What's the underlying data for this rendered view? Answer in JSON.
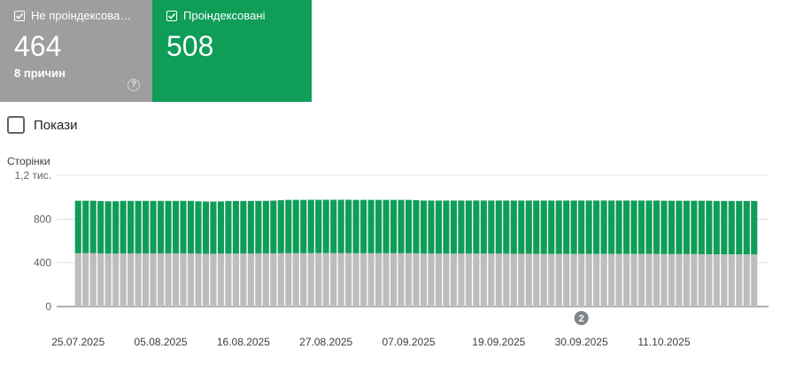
{
  "cards": {
    "not_indexed": {
      "title": "Не проіндексова…",
      "value": "464",
      "subtitle": "8 причин",
      "help": "?"
    },
    "indexed": {
      "title": "Проіндексовані",
      "value": "508",
      "help": "?"
    }
  },
  "show_toggle": {
    "label": "Покази",
    "checked": false
  },
  "colors": {
    "not_indexed": "#bdbdbd",
    "indexed": "#0f9d58",
    "grid": "#e0e0e0",
    "axis": "#5f6368"
  },
  "chart_data": {
    "type": "bar",
    "stacked": true,
    "ylabel": "Сторінки",
    "ylim": [
      0,
      1200
    ],
    "y_ticks": [
      {
        "value": 0,
        "label": "0"
      },
      {
        "value": 400,
        "label": "400"
      },
      {
        "value": 800,
        "label": "800"
      },
      {
        "value": 1200,
        "label": "1,2 тис."
      }
    ],
    "x_tick_labels": [
      "25.07.2025",
      "05.08.2025",
      "16.08.2025",
      "27.08.2025",
      "07.09.2025",
      "19.09.2025",
      "30.09.2025",
      "11.10.2025"
    ],
    "x_tick_index": [
      0,
      11,
      22,
      33,
      44,
      56,
      67,
      78
    ],
    "annotation": {
      "label": "2",
      "index": 67
    },
    "series": [
      {
        "name": "Не проіндексова…",
        "values": [
          488,
          489,
          489,
          486,
          485,
          485,
          486,
          486,
          486,
          486,
          486,
          486,
          486,
          486,
          486,
          486,
          484,
          483,
          483,
          484,
          485,
          485,
          485,
          485,
          486,
          486,
          487,
          488,
          488,
          488,
          488,
          489,
          489,
          489,
          489,
          489,
          489,
          488,
          488,
          488,
          488,
          488,
          488,
          488,
          488,
          487,
          485,
          485,
          485,
          485,
          485,
          485,
          485,
          485,
          485,
          484,
          484,
          484,
          483,
          483,
          483,
          482,
          482,
          482,
          482,
          482,
          482,
          482,
          482,
          482,
          482,
          482,
          482,
          482,
          482,
          482,
          482,
          482,
          480,
          480,
          480,
          480,
          480,
          479,
          479,
          478,
          478,
          478,
          478,
          478,
          478
        ]
      },
      {
        "name": "Проіндексовані",
        "values": [
          480,
          479,
          479,
          479,
          478,
          478,
          481,
          481,
          481,
          481,
          481,
          481,
          481,
          481,
          481,
          481,
          479,
          478,
          478,
          478,
          481,
          481,
          481,
          481,
          481,
          481,
          482,
          485,
          488,
          488,
          488,
          488,
          488,
          488,
          488,
          488,
          488,
          488,
          488,
          488,
          488,
          488,
          488,
          488,
          488,
          487,
          485,
          485,
          485,
          485,
          485,
          485,
          485,
          485,
          485,
          486,
          486,
          486,
          487,
          487,
          487,
          488,
          488,
          488,
          488,
          488,
          488,
          488,
          488,
          488,
          488,
          488,
          488,
          488,
          488,
          488,
          488,
          488,
          488,
          488,
          488,
          488,
          488,
          489,
          489,
          488,
          488,
          488,
          488,
          488,
          488
        ]
      }
    ]
  }
}
